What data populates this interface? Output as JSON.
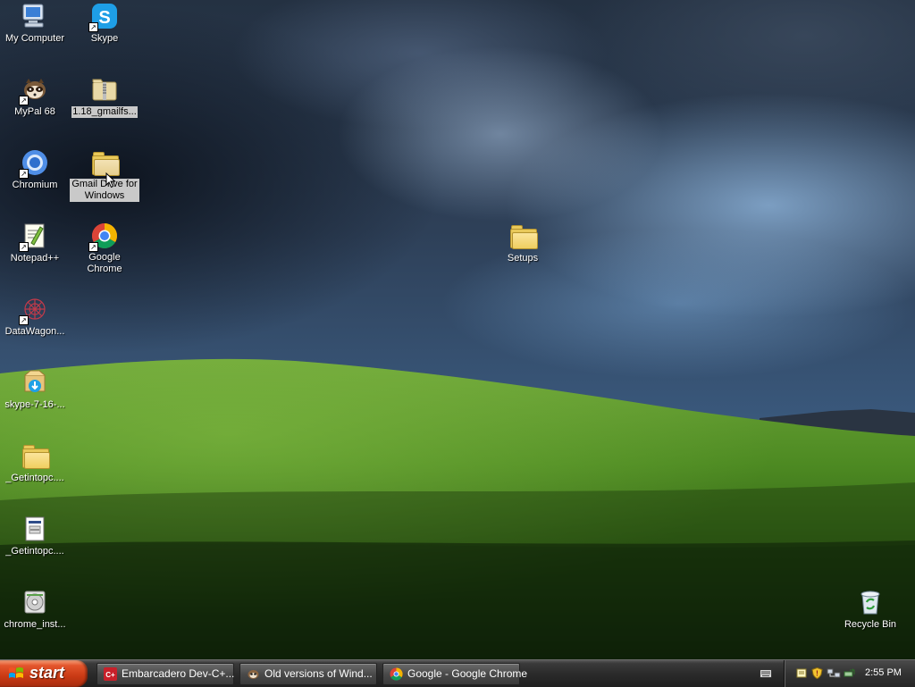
{
  "desktop": {
    "icons": {
      "my_computer": "My Computer",
      "skype": "Skype",
      "mypal": "MyPal 68",
      "gmailfs": "1.18_gmailfs...",
      "chromium": "Chromium",
      "gmail_drive": "Gmail Drive for Windows",
      "notepadpp": "Notepad++",
      "google_chrome": "Google Chrome",
      "setups": "Setups",
      "datawagon": "DataWagon...",
      "skype_installer": "skype-7-16-...",
      "getintopc_folder": "_Getintopc....",
      "getintopc_file": "_Getintopc....",
      "chrome_installer": "chrome_inst...",
      "recycle_bin": "Recycle Bin"
    }
  },
  "taskbar": {
    "start_label": "start",
    "tasks": [
      {
        "label": "Embarcadero Dev-C+...",
        "icon": "devcpp-icon"
      },
      {
        "label": "Old versions of Wind...",
        "icon": "app-icon"
      },
      {
        "label": "Google - Google Chrome",
        "icon": "chrome-icon"
      }
    ],
    "clock": "2:55 PM"
  },
  "colors": {
    "start_button": "#d8461c",
    "taskbar": "#2b2b2b",
    "selection": "#c9c9c9"
  }
}
